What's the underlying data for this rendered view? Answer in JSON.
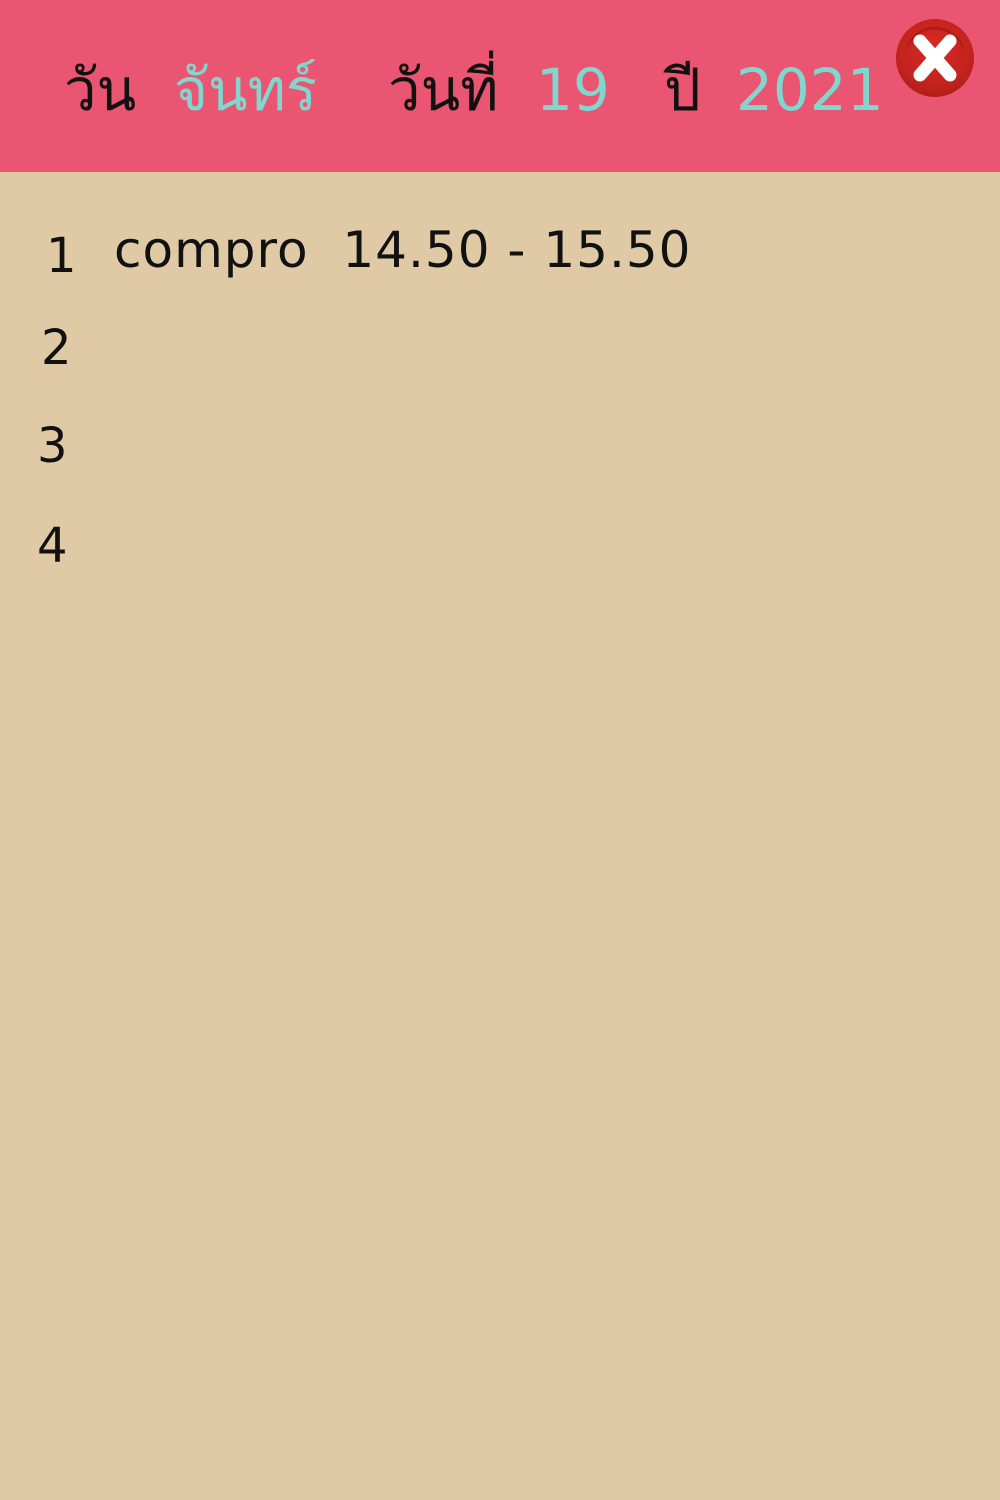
{
  "header": {
    "day_label": "วัน",
    "day_value": "จันทร์",
    "date_label": "วันที่",
    "date_value": "19",
    "year_label": "ปี",
    "year_value": "2021",
    "close_icon": "close-icon",
    "background_color": "#ea5671",
    "value_color": "#7fd7d0"
  },
  "schedule": {
    "background_color": "#e0caa6",
    "rows": [
      {
        "number": "1",
        "text": "compro  14.50 - 15.50"
      },
      {
        "number": "2",
        "text": ""
      },
      {
        "number": "3",
        "text": ""
      },
      {
        "number": "4",
        "text": ""
      }
    ]
  }
}
